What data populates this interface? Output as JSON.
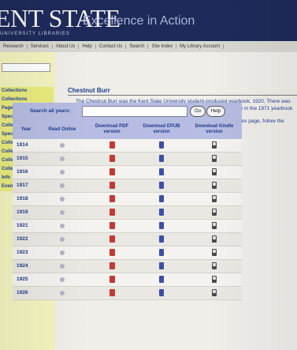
{
  "header": {
    "logo": "ENT STATE",
    "tagline": "Excellence in Action",
    "sublogo": "UNIVERSITY LIBRARIES"
  },
  "nav": {
    "items": [
      "Research",
      "Services",
      "About Us",
      "Help",
      "Contact Us",
      "Search",
      "Site Index",
      "My Library Account"
    ]
  },
  "sidebar": {
    "items": [
      "Collections",
      "Collections",
      "Pages",
      "Special",
      "Collections",
      "Special",
      "Collections",
      "Collections",
      "Collection",
      "Collection",
      "Info",
      "Events"
    ]
  },
  "main": {
    "title": "Chestnut Burr",
    "intro_1": "The Chestnut Burr was the Kent State University student-produced yearbook, 1920. There was no yearbook published in 1920. The Kent State shootings of the university in the 1971 yearbook.",
    "intro_2": "Browse or search digital copies of the KSU yearbook. To return to this index page, follow the links."
  },
  "search": {
    "label": "Search all years:",
    "value": "",
    "go": "Go",
    "help": "Help"
  },
  "table": {
    "headers": [
      "Year",
      "Read Online",
      "Download PDF version",
      "Download EPUB version",
      "Download Kindle version"
    ],
    "rows": [
      {
        "year": "1914"
      },
      {
        "year": "1915"
      },
      {
        "year": "1916"
      },
      {
        "year": "1917"
      },
      {
        "year": "1918"
      },
      {
        "year": "1919"
      },
      {
        "year": "1921"
      },
      {
        "year": "1922"
      },
      {
        "year": "1923"
      },
      {
        "year": "1924"
      },
      {
        "year": "1925"
      },
      {
        "year": "1926"
      }
    ]
  },
  "colors": {
    "header_bg": "#1e2a5a",
    "sidebar_bg": "#f3f3bf",
    "link_blue": "#1f3b8c",
    "table_header_bg": "#b7bde2"
  }
}
